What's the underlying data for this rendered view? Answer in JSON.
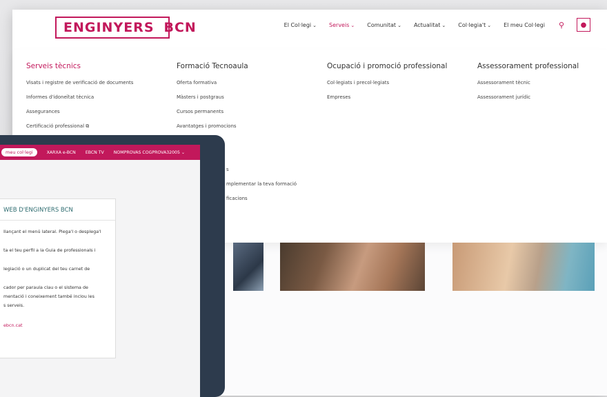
{
  "brand": {
    "left": "ENGINYERS",
    "right": "BCN",
    "accent": "#c2185b"
  },
  "nav": {
    "items": [
      {
        "label": "El Col·legi",
        "chevron": true,
        "active": false
      },
      {
        "label": "Serveis",
        "chevron": true,
        "active": true
      },
      {
        "label": "Comunitat",
        "chevron": true,
        "active": false
      },
      {
        "label": "Actualitat",
        "chevron": true,
        "active": false
      },
      {
        "label": "Col·legia't",
        "chevron": true,
        "active": false
      },
      {
        "label": "El meu Col·legi",
        "chevron": false,
        "active": false
      }
    ],
    "search_icon": "search-icon",
    "user_icon": "user-icon"
  },
  "mega": {
    "col1": {
      "title": "Serveis tècnics",
      "links": [
        "Visats i registre de verificació de documents",
        "Informes d'idoneïtat tècnica",
        "Assegurances",
        "Certificació professional"
      ]
    },
    "col2": {
      "title": "Formació Tecnoaula",
      "links": [
        "Oferta formativa",
        "Màsters i postgraus",
        "Cursos permanents",
        "Avantatges i promocions"
      ]
    },
    "col3": {
      "title": "Ocupació i promoció professional",
      "links": [
        "Col·legiats i precol·legiats",
        "Empreses"
      ]
    },
    "col4": {
      "title": "Assessorament professional",
      "links": [
        "Assessorament tècnic",
        "Assessorament jurídic"
      ]
    },
    "partial_lines": [
      "s",
      "mplementar la teva formació",
      "ficacions"
    ]
  },
  "tablet": {
    "pill": "meu col·legi",
    "bar_items": [
      "XARXA e-BCN",
      "EBCN TV",
      "NOMPROVAS COGPROVA32005"
    ],
    "card": {
      "title": "WEB D'ENGINYERS BCN",
      "p1": "llançant el menú lateral. Plega'l o desplega'l",
      "p2": "ta el teu perfil a la Guia de professionals i",
      "p3": "legiació o un duplicat del teu carnet de",
      "p4a": "cador per paraula clau o el sistema de",
      "p4b": "mentació i coneixement també inclou les",
      "p4c": "s serveis.",
      "mail": "ebcn.cat"
    }
  }
}
